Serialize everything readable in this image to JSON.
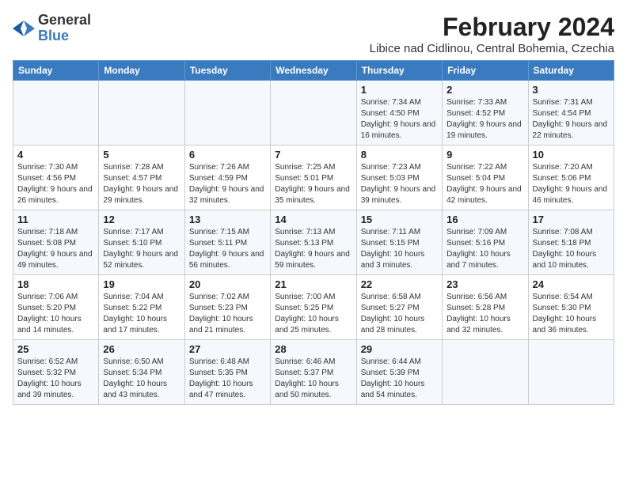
{
  "app": {
    "name_general": "General",
    "name_blue": "Blue"
  },
  "title": "February 2024",
  "location": "Libice nad Cidlinou, Central Bohemia, Czechia",
  "days_of_week": [
    "Sunday",
    "Monday",
    "Tuesday",
    "Wednesday",
    "Thursday",
    "Friday",
    "Saturday"
  ],
  "weeks": [
    [
      {
        "day": "",
        "info": ""
      },
      {
        "day": "",
        "info": ""
      },
      {
        "day": "",
        "info": ""
      },
      {
        "day": "",
        "info": ""
      },
      {
        "day": "1",
        "info": "Sunrise: 7:34 AM\nSunset: 4:50 PM\nDaylight: 9 hours and 16 minutes."
      },
      {
        "day": "2",
        "info": "Sunrise: 7:33 AM\nSunset: 4:52 PM\nDaylight: 9 hours and 19 minutes."
      },
      {
        "day": "3",
        "info": "Sunrise: 7:31 AM\nSunset: 4:54 PM\nDaylight: 9 hours and 22 minutes."
      }
    ],
    [
      {
        "day": "4",
        "info": "Sunrise: 7:30 AM\nSunset: 4:56 PM\nDaylight: 9 hours and 26 minutes."
      },
      {
        "day": "5",
        "info": "Sunrise: 7:28 AM\nSunset: 4:57 PM\nDaylight: 9 hours and 29 minutes."
      },
      {
        "day": "6",
        "info": "Sunrise: 7:26 AM\nSunset: 4:59 PM\nDaylight: 9 hours and 32 minutes."
      },
      {
        "day": "7",
        "info": "Sunrise: 7:25 AM\nSunset: 5:01 PM\nDaylight: 9 hours and 35 minutes."
      },
      {
        "day": "8",
        "info": "Sunrise: 7:23 AM\nSunset: 5:03 PM\nDaylight: 9 hours and 39 minutes."
      },
      {
        "day": "9",
        "info": "Sunrise: 7:22 AM\nSunset: 5:04 PM\nDaylight: 9 hours and 42 minutes."
      },
      {
        "day": "10",
        "info": "Sunrise: 7:20 AM\nSunset: 5:06 PM\nDaylight: 9 hours and 46 minutes."
      }
    ],
    [
      {
        "day": "11",
        "info": "Sunrise: 7:18 AM\nSunset: 5:08 PM\nDaylight: 9 hours and 49 minutes."
      },
      {
        "day": "12",
        "info": "Sunrise: 7:17 AM\nSunset: 5:10 PM\nDaylight: 9 hours and 52 minutes."
      },
      {
        "day": "13",
        "info": "Sunrise: 7:15 AM\nSunset: 5:11 PM\nDaylight: 9 hours and 56 minutes."
      },
      {
        "day": "14",
        "info": "Sunrise: 7:13 AM\nSunset: 5:13 PM\nDaylight: 9 hours and 59 minutes."
      },
      {
        "day": "15",
        "info": "Sunrise: 7:11 AM\nSunset: 5:15 PM\nDaylight: 10 hours and 3 minutes."
      },
      {
        "day": "16",
        "info": "Sunrise: 7:09 AM\nSunset: 5:16 PM\nDaylight: 10 hours and 7 minutes."
      },
      {
        "day": "17",
        "info": "Sunrise: 7:08 AM\nSunset: 5:18 PM\nDaylight: 10 hours and 10 minutes."
      }
    ],
    [
      {
        "day": "18",
        "info": "Sunrise: 7:06 AM\nSunset: 5:20 PM\nDaylight: 10 hours and 14 minutes."
      },
      {
        "day": "19",
        "info": "Sunrise: 7:04 AM\nSunset: 5:22 PM\nDaylight: 10 hours and 17 minutes."
      },
      {
        "day": "20",
        "info": "Sunrise: 7:02 AM\nSunset: 5:23 PM\nDaylight: 10 hours and 21 minutes."
      },
      {
        "day": "21",
        "info": "Sunrise: 7:00 AM\nSunset: 5:25 PM\nDaylight: 10 hours and 25 minutes."
      },
      {
        "day": "22",
        "info": "Sunrise: 6:58 AM\nSunset: 5:27 PM\nDaylight: 10 hours and 28 minutes."
      },
      {
        "day": "23",
        "info": "Sunrise: 6:56 AM\nSunset: 5:28 PM\nDaylight: 10 hours and 32 minutes."
      },
      {
        "day": "24",
        "info": "Sunrise: 6:54 AM\nSunset: 5:30 PM\nDaylight: 10 hours and 36 minutes."
      }
    ],
    [
      {
        "day": "25",
        "info": "Sunrise: 6:52 AM\nSunset: 5:32 PM\nDaylight: 10 hours and 39 minutes."
      },
      {
        "day": "26",
        "info": "Sunrise: 6:50 AM\nSunset: 5:34 PM\nDaylight: 10 hours and 43 minutes."
      },
      {
        "day": "27",
        "info": "Sunrise: 6:48 AM\nSunset: 5:35 PM\nDaylight: 10 hours and 47 minutes."
      },
      {
        "day": "28",
        "info": "Sunrise: 6:46 AM\nSunset: 5:37 PM\nDaylight: 10 hours and 50 minutes."
      },
      {
        "day": "29",
        "info": "Sunrise: 6:44 AM\nSunset: 5:39 PM\nDaylight: 10 hours and 54 minutes."
      },
      {
        "day": "",
        "info": ""
      },
      {
        "day": "",
        "info": ""
      }
    ]
  ]
}
